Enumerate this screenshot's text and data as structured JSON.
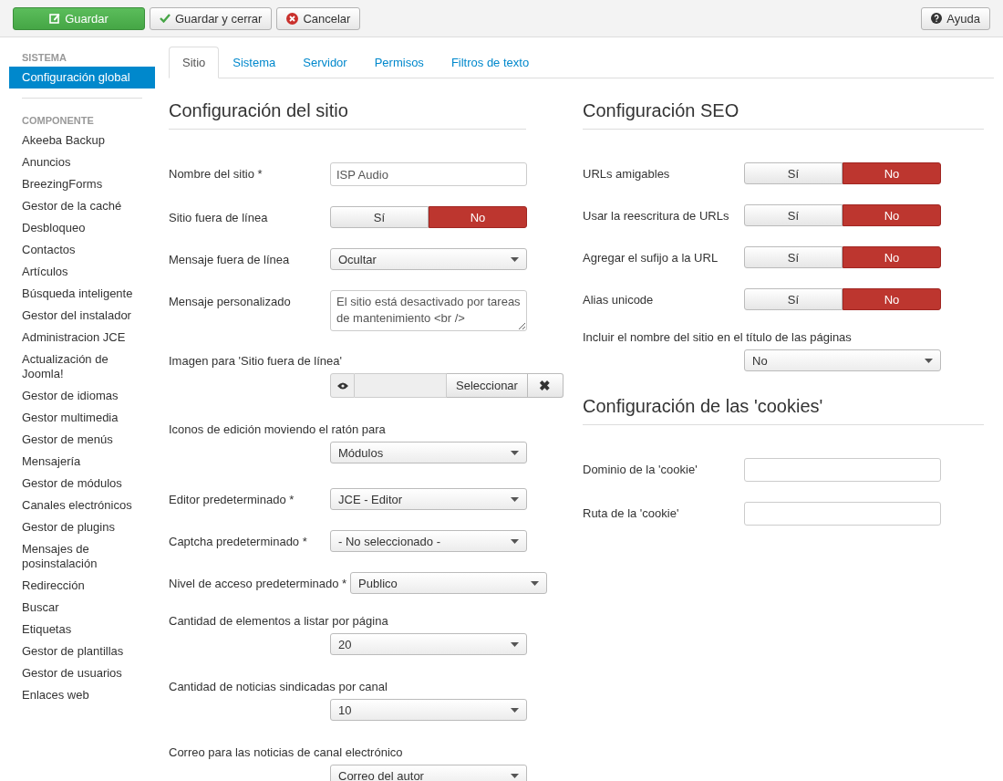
{
  "toolbar": {
    "buttons": [
      {
        "label": "Guardar",
        "kind": "primary"
      },
      {
        "label": "Guardar y cerrar",
        "kind": "check"
      },
      {
        "label": "Cancelar",
        "kind": "cancel"
      }
    ],
    "help": {
      "label": "Ayuda"
    }
  },
  "sidebar": {
    "sections": [
      {
        "heading": "SISTEMA",
        "items": [
          {
            "label": "Configuración global",
            "selected": true
          }
        ]
      },
      {
        "heading": "COMPONENTE",
        "items": [
          {
            "label": "Akeeba Backup",
            "selected": false
          },
          {
            "label": "Anuncios",
            "selected": false
          },
          {
            "label": "BreezingForms",
            "selected": false
          },
          {
            "label": "Gestor de la caché",
            "selected": false
          },
          {
            "label": "Desbloqueo",
            "selected": false
          },
          {
            "label": "Contactos",
            "selected": false
          },
          {
            "label": "Artículos",
            "selected": false
          },
          {
            "label": "Búsqueda inteligente",
            "selected": false
          },
          {
            "label": "Gestor del instalador",
            "selected": false
          },
          {
            "label": "Administracion JCE",
            "selected": false
          },
          {
            "label": "Actualización de Joomla!",
            "selected": false
          },
          {
            "label": "Gestor de idiomas",
            "selected": false
          },
          {
            "label": "Gestor multimedia",
            "selected": false
          },
          {
            "label": "Gestor de menús",
            "selected": false
          },
          {
            "label": "Mensajería",
            "selected": false
          },
          {
            "label": "Gestor de módulos",
            "selected": false
          },
          {
            "label": "Canales electrónicos",
            "selected": false
          },
          {
            "label": "Gestor de plugins",
            "selected": false
          },
          {
            "label": "Mensajes de posinstalación",
            "selected": false
          },
          {
            "label": "Redirección",
            "selected": false
          },
          {
            "label": "Buscar",
            "selected": false
          },
          {
            "label": "Etiquetas",
            "selected": false
          },
          {
            "label": "Gestor de plantillas",
            "selected": false
          },
          {
            "label": "Gestor de usuarios",
            "selected": false
          },
          {
            "label": "Enlaces web",
            "selected": false
          }
        ]
      }
    ]
  },
  "tabs": [
    {
      "label": "Sitio",
      "selected": true
    },
    {
      "label": "Sistema",
      "selected": false
    },
    {
      "label": "Servidor",
      "selected": false
    },
    {
      "label": "Permisos",
      "selected": false
    },
    {
      "label": "Filtros de texto",
      "selected": false
    }
  ],
  "columns": [
    {
      "sections": [
        {
          "title": "Configuración del sitio",
          "fields": [
            {
              "label": "Nombre del sitio *",
              "kind": "text",
              "stacked": false,
              "value": "ISP Audio"
            },
            {
              "label": "Sitio fuera de línea",
              "kind": "toggle",
              "stacked": false,
              "options": [
                {
                  "label": "Sí",
                  "selected": false
                },
                {
                  "label": "No",
                  "selected": true
                }
              ]
            },
            {
              "label": "Mensaje fuera de línea",
              "kind": "select",
              "stacked": false,
              "value": "Ocultar"
            },
            {
              "label": "Mensaje personalizado",
              "kind": "textarea",
              "stacked": false,
              "value": "El sitio está desactivado por tareas de mantenimiento <br />"
            },
            {
              "label": "Imagen para 'Sitio fuera de línea'",
              "kind": "media",
              "stacked": true,
              "button": "Seleccionar",
              "clear": "✖"
            },
            {
              "label": "Iconos de edición moviendo el ratón para",
              "kind": "select",
              "stacked": true,
              "value": "Módulos"
            },
            {
              "label": "Editor predeterminado *",
              "kind": "select",
              "stacked": false,
              "value": "JCE - Editor"
            },
            {
              "label": "Captcha predeterminado *",
              "kind": "select",
              "stacked": false,
              "value": "- No seleccionado -"
            },
            {
              "label": "Nivel de acceso predeterminado *",
              "kind": "select",
              "stacked": false,
              "value": "Publico"
            },
            {
              "label": "Cantidad de elementos a listar por página",
              "kind": "select",
              "stacked": true,
              "value": "20"
            },
            {
              "label": "Cantidad de noticias sindicadas por canal",
              "kind": "select",
              "stacked": true,
              "value": "10"
            },
            {
              "label": "Correo para las noticias de canal electrónico",
              "kind": "select",
              "stacked": true,
              "value": "Correo del autor"
            }
          ]
        }
      ]
    },
    {
      "sections": [
        {
          "title": "Configuración SEO",
          "fields": [
            {
              "label": "URLs amigables",
              "kind": "toggle",
              "stacked": false,
              "options": [
                {
                  "label": "Sí",
                  "selected": false
                },
                {
                  "label": "No",
                  "selected": true
                }
              ]
            },
            {
              "label": "Usar la reescritura de URLs",
              "kind": "toggle",
              "stacked": false,
              "options": [
                {
                  "label": "Sí",
                  "selected": false
                },
                {
                  "label": "No",
                  "selected": true
                }
              ]
            },
            {
              "label": "Agregar el sufijo a la URL",
              "kind": "toggle",
              "stacked": false,
              "options": [
                {
                  "label": "Sí",
                  "selected": false
                },
                {
                  "label": "No",
                  "selected": true
                }
              ]
            },
            {
              "label": "Alias unicode",
              "kind": "toggle",
              "stacked": false,
              "options": [
                {
                  "label": "Sí",
                  "selected": false
                },
                {
                  "label": "No",
                  "selected": true
                }
              ]
            },
            {
              "label": "Incluir el nombre del sitio en el título de las páginas",
              "kind": "select",
              "stacked": true,
              "value": "No"
            }
          ]
        },
        {
          "title": "Configuración de las 'cookies'",
          "fields": [
            {
              "label": "Dominio de la 'cookie'",
              "kind": "text",
              "stacked": false
            },
            {
              "label": "Ruta de la 'cookie'",
              "kind": "text",
              "stacked": false
            }
          ]
        }
      ]
    }
  ]
}
